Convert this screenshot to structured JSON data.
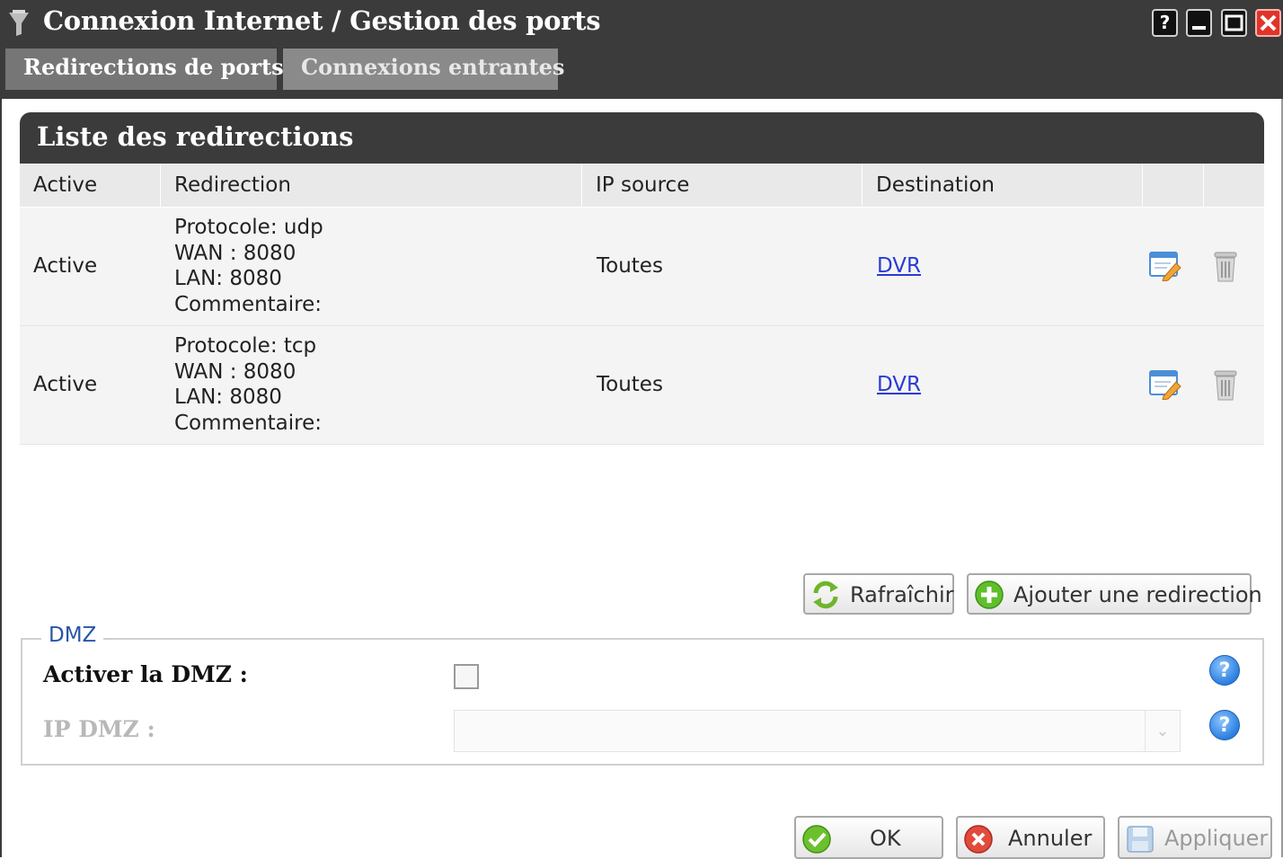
{
  "window": {
    "title": "Connexion Internet / Gestion des ports",
    "controls": {
      "help": "?",
      "minimize": "‒",
      "maximize": "□",
      "close": "✕"
    }
  },
  "tabs": [
    {
      "label": "Redirections de ports",
      "active": true
    },
    {
      "label": "Connexions entrantes",
      "active": false
    }
  ],
  "panel": {
    "title": "Liste des redirections",
    "columns": [
      "Active",
      "Redirection",
      "IP source",
      "Destination",
      "",
      ""
    ],
    "rows": [
      {
        "active": "Active",
        "protocol": "Protocole: udp",
        "wan": "WAN : 8080",
        "lan": "LAN: 8080",
        "comment": "Commentaire:",
        "ip_source": "Toutes",
        "destination": "DVR"
      },
      {
        "active": "Active",
        "protocol": "Protocole: tcp",
        "wan": "WAN : 8080",
        "lan": "LAN: 8080",
        "comment": "Commentaire:",
        "ip_source": "Toutes",
        "destination": "DVR"
      }
    ]
  },
  "actions": {
    "refresh": "Rafraîchir",
    "add": "Ajouter une redirection"
  },
  "dmz": {
    "legend": "DMZ",
    "enable_label": "Activer la DMZ :",
    "enabled": false,
    "ip_label": "IP DMZ :",
    "ip_value": ""
  },
  "footer": {
    "ok": "OK",
    "cancel": "Annuler",
    "apply": "Appliquer"
  },
  "colors": {
    "header_dark": "#3b3b3b",
    "link": "#2a3bd6",
    "legend": "#2a56a8"
  }
}
